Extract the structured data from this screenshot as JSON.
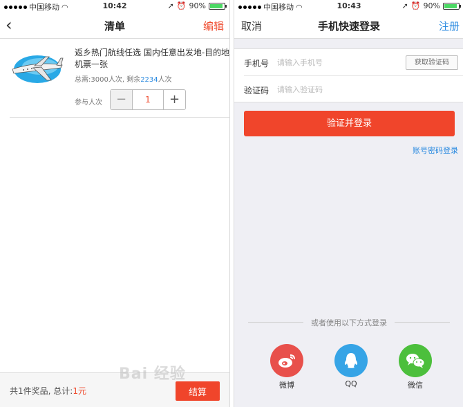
{
  "left": {
    "status": {
      "carrier": "中国移动",
      "time": "10:42",
      "battery": "90%"
    },
    "nav": {
      "back_icon": "chevron-left-icon",
      "title": "清单",
      "edit": "编辑"
    },
    "item": {
      "name": "返乡热门航线任选 国内任意出发地-目的地机票一张",
      "need_prefix": "总需:3000人次, 剩余",
      "remaining": "2234",
      "need_suffix": "人次",
      "join_label": "参与人次",
      "minus": "−",
      "quantity": "1",
      "plus": "+"
    },
    "footer": {
      "summary_prefix": "共1件奖品, 总计:",
      "total": "1元",
      "checkout": "结算"
    }
  },
  "right": {
    "status": {
      "carrier": "中国移动",
      "time": "10:43",
      "battery": "90%"
    },
    "nav": {
      "cancel": "取消",
      "title": "手机快速登录",
      "register": "注册"
    },
    "form": {
      "phone_label": "手机号",
      "phone_placeholder": "请输入手机号",
      "get_code": "获取验证码",
      "code_label": "验证码",
      "code_placeholder": "请输入验证码"
    },
    "login_button": "验证并登录",
    "password_login": "账号密码登录",
    "divider_text": "或者使用以下方式登录",
    "social": [
      {
        "label": "微博",
        "icon": "weibo-icon"
      },
      {
        "label": "QQ",
        "icon": "qq-icon"
      },
      {
        "label": "微信",
        "icon": "wechat-icon"
      }
    ]
  },
  "watermark": "Bai 经验",
  "colors": {
    "accent": "#f0452b",
    "link": "#2a8ae0",
    "weibo": "#e8504b",
    "qq": "#36a4e6",
    "wechat": "#4cbf3c"
  }
}
